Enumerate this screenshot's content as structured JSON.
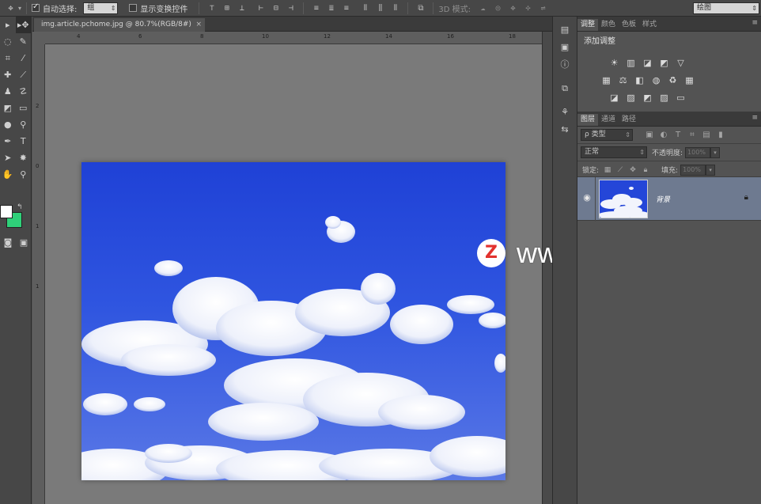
{
  "options_bar": {
    "auto_select_label": "自动选择:",
    "auto_select_value": "组",
    "show_transform_label": "显示变换控件",
    "mode_3d_label": "3D 模式:",
    "workspace_value": "绘图"
  },
  "document": {
    "tab_title": "img.article.pchome.jpg @ 80.7%(RGB/8#)",
    "close_glyph": "×"
  },
  "rulers": {
    "top": [
      "4",
      "6",
      "8",
      "10",
      "12",
      "14",
      "16",
      "18"
    ],
    "left": [
      "2",
      "0",
      "1",
      "1"
    ]
  },
  "adjust_panel": {
    "tabs": [
      {
        "label": "调整",
        "active": true
      },
      {
        "label": "颜色",
        "active": false
      },
      {
        "label": "色板",
        "active": false
      },
      {
        "label": "样式",
        "active": false
      }
    ],
    "title": "添加调整"
  },
  "layers_panel": {
    "tabs": [
      {
        "label": "图层",
        "active": true
      },
      {
        "label": "通道",
        "active": false
      },
      {
        "label": "路径",
        "active": false
      }
    ],
    "filter_label": "ρ 类型",
    "blend_mode": "正常",
    "opacity_label": "不透明度:",
    "opacity_value": "100%",
    "lock_label": "锁定:",
    "fill_label": "填充:",
    "fill_value": "100%",
    "layer": {
      "name": "背景",
      "visible": true,
      "locked": true
    }
  },
  "watermark": {
    "logo": "Z",
    "text": "www.MacZ.com"
  },
  "colors": {
    "foreground": "#ffffff",
    "background": "#2fd079",
    "sky_top": "#1f41d6",
    "layer_selected": "#6e7a90"
  }
}
